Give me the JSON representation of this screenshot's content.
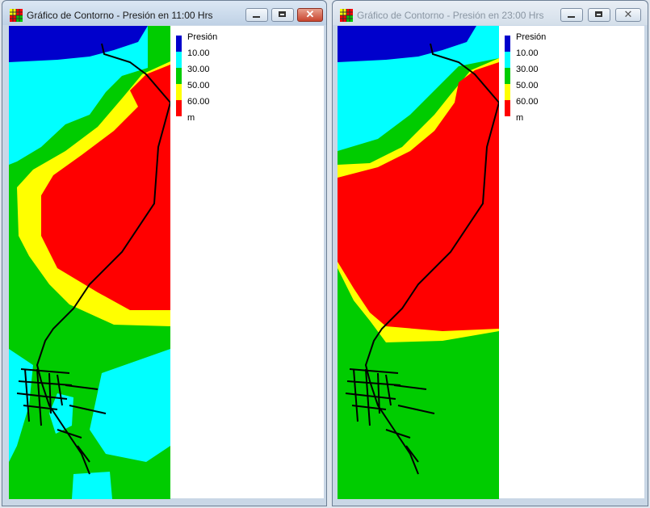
{
  "windows": [
    {
      "title": "Gráfico de Contorno - Presión en 11:00 Hrs",
      "active": true,
      "controls": {
        "minimize": "minimize",
        "maximize": "maximize",
        "close": "close"
      },
      "legend": {
        "title": "Presión",
        "levels": [
          "10.00",
          "30.00",
          "50.00",
          "60.00"
        ],
        "unit": "m",
        "colors": [
          "#0000cc",
          "#00ffff",
          "#00cc00",
          "#ffff00",
          "#ff0000"
        ]
      }
    },
    {
      "title": "Gráfico de Contorno - Presión en 23:00 Hrs",
      "active": false,
      "controls": {
        "minimize": "minimize",
        "maximize": "maximize",
        "close": "close"
      },
      "legend": {
        "title": "Presión",
        "levels": [
          "10.00",
          "30.00",
          "50.00",
          "60.00"
        ],
        "unit": "m",
        "colors": [
          "#0000cc",
          "#00ffff",
          "#00cc00",
          "#ffff00",
          "#ff0000"
        ]
      }
    }
  ]
}
